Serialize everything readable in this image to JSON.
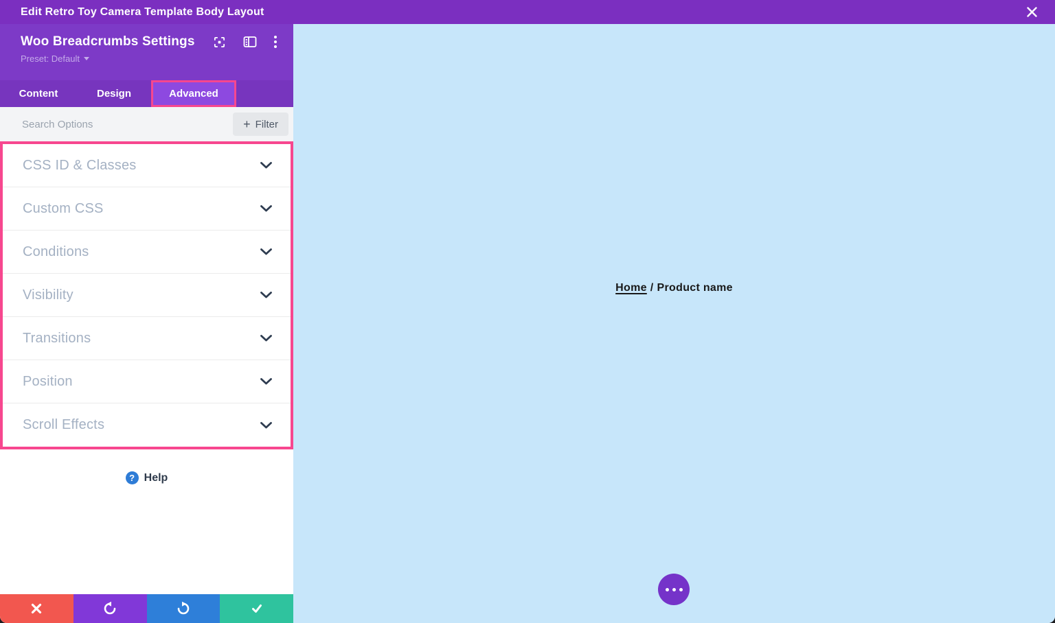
{
  "window": {
    "title": "Edit Retro Toy Camera Template Body Layout"
  },
  "panel": {
    "title": "Woo Breadcrumbs Settings",
    "preset": "Preset: Default",
    "tabs": [
      {
        "label": "Content",
        "active": false
      },
      {
        "label": "Design",
        "active": false
      },
      {
        "label": "Advanced",
        "active": true,
        "highlighted": true
      }
    ],
    "search": {
      "placeholder": "Search Options",
      "plus": "+",
      "filter_label": "Filter"
    },
    "accordion": [
      {
        "label": "CSS ID & Classes"
      },
      {
        "label": "Custom CSS"
      },
      {
        "label": "Conditions"
      },
      {
        "label": "Visibility"
      },
      {
        "label": "Transitions"
      },
      {
        "label": "Position"
      },
      {
        "label": "Scroll Effects"
      }
    ],
    "help_label": "Help"
  },
  "canvas": {
    "breadcrumb": {
      "home": "Home",
      "separator": "/",
      "current": "Product name"
    }
  },
  "colors": {
    "topbar_purple": "#7b2fc0",
    "header_purple": "#7d3ac7",
    "tabbar_purple": "#7735be",
    "active_tab_purple": "#8d49e0",
    "highlight_pink": "#f7478f",
    "canvas_blue": "#c7e6fa",
    "discard_red": "#f2574f",
    "undo_purple": "#8138d8",
    "redo_blue": "#2e7fd9",
    "save_green": "#2fc39e",
    "fab_purple": "#7533c9",
    "help_blue": "#2e7cd6"
  }
}
